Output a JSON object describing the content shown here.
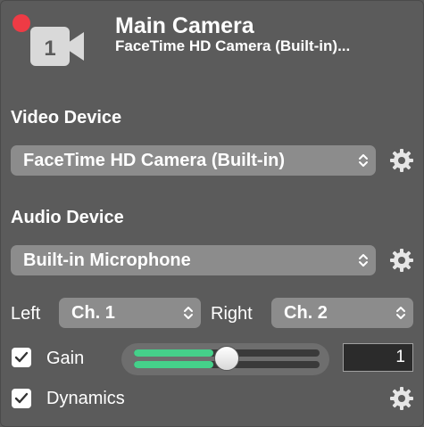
{
  "header": {
    "title": "Main Camera",
    "subtitle": "FaceTime HD Camera (Built-in)...",
    "badge_number": "1",
    "record_color": "#ee3b45"
  },
  "video": {
    "label": "Video Device",
    "selected": "FaceTime HD Camera (Built-in)"
  },
  "audio": {
    "label": "Audio Device",
    "selected": "Built-in Microphone",
    "left_label": "Left",
    "left_channel": "Ch. 1",
    "right_label": "Right",
    "right_channel": "Ch. 2"
  },
  "gain": {
    "label": "Gain",
    "checked": true,
    "value": "1",
    "level_left": 0.43,
    "level_right": 0.43,
    "meter_color": "#45d08a"
  },
  "dynamics": {
    "label": "Dynamics",
    "checked": true
  },
  "icons": [
    "record-dot-icon",
    "camera-icon",
    "gear-icon",
    "updown-chevron-icon",
    "checkmark-icon"
  ]
}
